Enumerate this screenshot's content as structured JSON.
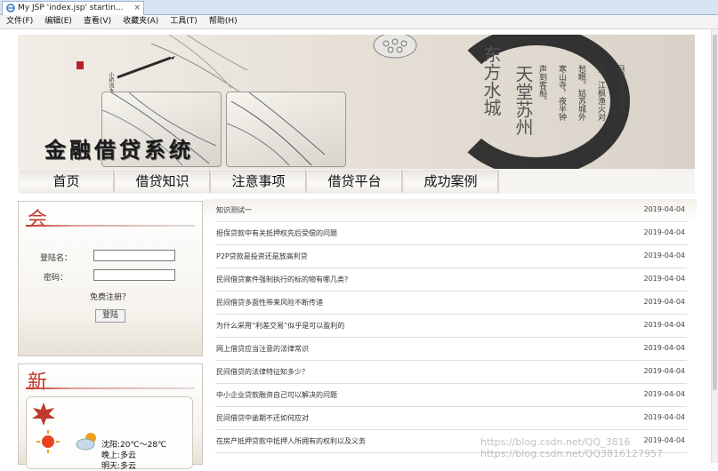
{
  "browser": {
    "tab_title": "My JSP 'index.jsp' startin...",
    "menu": [
      "文件(F)",
      "编辑(E)",
      "查看(V)",
      "收藏夹(A)",
      "工具(T)",
      "帮助(H)"
    ]
  },
  "banner": {
    "logo_text": "金融借贷系统",
    "poem_large_1": "东方水城",
    "poem_large_2": "天堂苏州",
    "poem_small": "月落乌啼霜满天，江枫渔火对愁眠。姑苏城外寒山寺，夜半钟声到客船。",
    "calligraphy": "小桥流水人家 古道西风瘦马 一夜生"
  },
  "nav": [
    "首页",
    "借贷知识",
    "注意事项",
    "借贷平台",
    "成功案例"
  ],
  "login": {
    "heading": "会",
    "username_label": "登陆名：",
    "password_label": "密码：",
    "register_text": "免费注册？",
    "submit_label": "登陆",
    "username_value": "",
    "password_value": ""
  },
  "news_panel": {
    "heading": "新",
    "weather": {
      "line1": "沈阳:20℃～28℃",
      "line2": "晚上:多云",
      "line3": "明天:多云"
    }
  },
  "articles": [
    {
      "title": "知识测试一",
      "date": "2019-04-04"
    },
    {
      "title": "担保贷款中有关抵押权先后受偿的问题",
      "date": "2019-04-04"
    },
    {
      "title": "P2P贷款是投资还是放高利贷",
      "date": "2019-04-04"
    },
    {
      "title": "民间借贷案件强制执行的标的物有哪几类?",
      "date": "2019-04-04"
    },
    {
      "title": "民间借贷多面性带来风险不断传递",
      "date": "2019-04-04"
    },
    {
      "title": "为什么采用“利差交易”似乎是可以盈利的",
      "date": "2019-04-04"
    },
    {
      "title": "网上借贷应当注意的法律常识",
      "date": "2019-04-04"
    },
    {
      "title": "民间借贷的法律特征知多少？",
      "date": "2019-04-04"
    },
    {
      "title": "中小企业贷款融资自己可以解决的问题",
      "date": "2019-04-04"
    },
    {
      "title": "民间借贷中逾期不还如何应对",
      "date": "2019-04-04"
    },
    {
      "title": "在房产抵押贷款中抵押人所拥有的权利以及义务",
      "date": "2019-04-04"
    }
  ],
  "watermark": {
    "line1": "https://blog.csdn.net/QQ_3816",
    "line2": "https://blog.csdn.net/QQ3816127957"
  }
}
